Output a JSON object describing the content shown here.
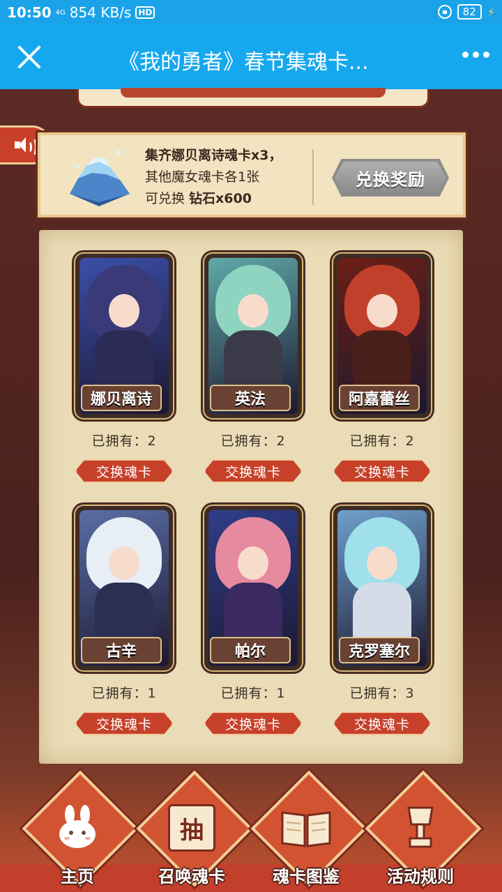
{
  "status_bar": {
    "time": "10:50",
    "network": "4G",
    "speed": "854 KB/s",
    "hd": "HD",
    "battery": "82"
  },
  "navbar": {
    "title": "《我的勇者》春节集魂卡..."
  },
  "reward": {
    "line1": "集齐娜贝离诗魂卡x3，",
    "line2": "其他魔女魂卡各1张",
    "line3_prefix": "可兑换 ",
    "line3_item": "钻石x600",
    "button": "兑换奖励"
  },
  "cards": [
    {
      "name": "娜贝离诗",
      "owned": "已拥有：2",
      "button": "交换魂卡",
      "hair": "#3a3a78",
      "body": "#2c2b56",
      "bg": "#3b4ea8"
    },
    {
      "name": "英法",
      "owned": "已拥有：2",
      "button": "交换魂卡",
      "hair": "#8fd3c1",
      "body": "#3a3a48",
      "bg": "#5fa9a7"
    },
    {
      "name": "阿嘉蕾丝",
      "owned": "已拥有：2",
      "button": "交换魂卡",
      "hair": "#c0402b",
      "body": "#4a1f1a",
      "bg": "#6b1f15"
    },
    {
      "name": "古辛",
      "owned": "已拥有：1",
      "button": "交换魂卡",
      "hair": "#e8eef6",
      "body": "#2c2e52",
      "bg": "#5a6ea5"
    },
    {
      "name": "帕尔",
      "owned": "已拥有：1",
      "button": "交换魂卡",
      "hair": "#e68aa0",
      "body": "#3a2a60",
      "bg": "#2f3e8a"
    },
    {
      "name": "克罗塞尔",
      "owned": "已拥有：3",
      "button": "交换魂卡",
      "hair": "#9fe0ea",
      "body": "#d6dbe8",
      "bg": "#6fa0cc"
    }
  ],
  "bottom_nav": [
    {
      "label": "主页",
      "icon": "bunny-icon"
    },
    {
      "label": "召唤魂卡",
      "icon": "summon-icon",
      "icon_char": "抽"
    },
    {
      "label": "魂卡图鉴",
      "icon": "book-icon"
    },
    {
      "label": "活动规则",
      "icon": "trophy-icon"
    }
  ]
}
